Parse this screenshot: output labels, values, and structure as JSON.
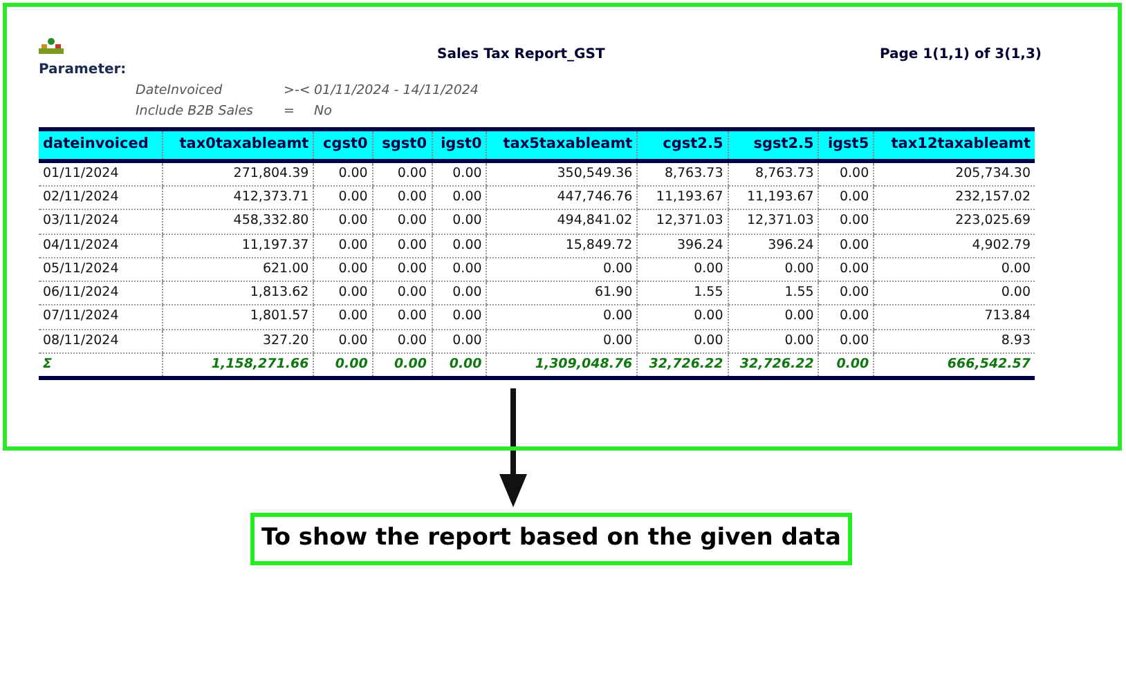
{
  "report": {
    "title": "Sales Tax Report_GST",
    "page": "Page 1(1,1) of 3(1,3)",
    "parameter_heading": "Parameter:",
    "parameters": [
      {
        "name": "DateInvoiced",
        "operator": ">-<",
        "value": "01/11/2024 - 14/11/2024"
      },
      {
        "name": "Include B2B Sales",
        "operator": "=",
        "value": "No"
      }
    ],
    "table": {
      "columns": [
        "dateinvoiced",
        "tax0taxableamt",
        "cgst0",
        "sgst0",
        "igst0",
        "tax5taxableamt",
        "cgst2.5",
        "sgst2.5",
        "igst5",
        "tax12taxableamt"
      ],
      "rows": [
        [
          "01/11/2024",
          "271,804.39",
          "0.00",
          "0.00",
          "0.00",
          "350,549.36",
          "8,763.73",
          "8,763.73",
          "0.00",
          "205,734.30"
        ],
        [
          "02/11/2024",
          "412,373.71",
          "0.00",
          "0.00",
          "0.00",
          "447,746.76",
          "11,193.67",
          "11,193.67",
          "0.00",
          "232,157.02"
        ],
        [
          "03/11/2024",
          "458,332.80",
          "0.00",
          "0.00",
          "0.00",
          "494,841.02",
          "12,371.03",
          "12,371.03",
          "0.00",
          "223,025.69"
        ],
        [
          "04/11/2024",
          "11,197.37",
          "0.00",
          "0.00",
          "0.00",
          "15,849.72",
          "396.24",
          "396.24",
          "0.00",
          "4,902.79"
        ],
        [
          "05/11/2024",
          "621.00",
          "0.00",
          "0.00",
          "0.00",
          "0.00",
          "0.00",
          "0.00",
          "0.00",
          "0.00"
        ],
        [
          "06/11/2024",
          "1,813.62",
          "0.00",
          "0.00",
          "0.00",
          "61.90",
          "1.55",
          "1.55",
          "0.00",
          "0.00"
        ],
        [
          "07/11/2024",
          "1,801.57",
          "0.00",
          "0.00",
          "0.00",
          "0.00",
          "0.00",
          "0.00",
          "0.00",
          "713.84"
        ],
        [
          "08/11/2024",
          "327.20",
          "0.00",
          "0.00",
          "0.00",
          "0.00",
          "0.00",
          "0.00",
          "0.00",
          "8.93"
        ]
      ],
      "totals": [
        "Σ",
        "1,158,271.66",
        "0.00",
        "0.00",
        "0.00",
        "1,309,048.76",
        "32,726.22",
        "32,726.22",
        "0.00",
        "666,542.57"
      ]
    }
  },
  "caption": "To show the report based on the given data"
}
